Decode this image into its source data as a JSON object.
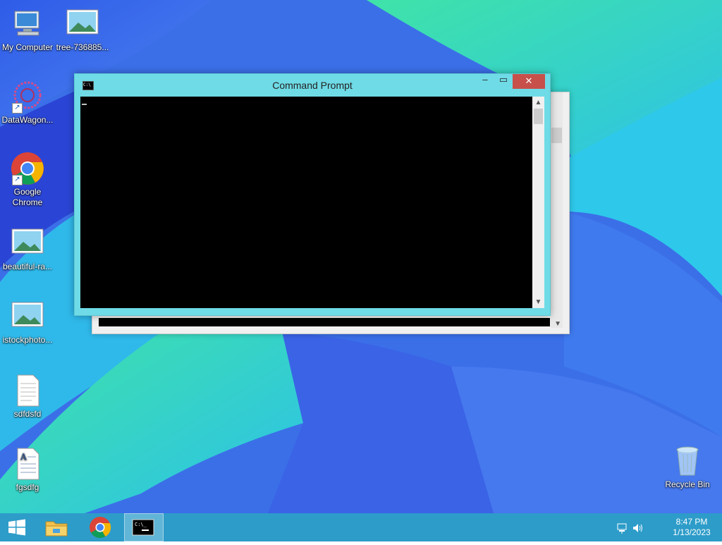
{
  "desktop": {
    "icons": [
      {
        "label": "My Computer",
        "icon": "computer-icon"
      },
      {
        "label": "tree-736885...",
        "icon": "image-file-icon"
      },
      {
        "label": "DataWagon...",
        "icon": "datawagon-icon"
      },
      {
        "label": "Google Chrome",
        "icon": "chrome-icon"
      },
      {
        "label": "beautiful-ra...",
        "icon": "image-file-icon"
      },
      {
        "label": "istockphoto...",
        "icon": "image-file-icon"
      },
      {
        "label": "sdfdsfd",
        "icon": "text-file-icon"
      },
      {
        "label": "fgsdfg",
        "icon": "document-file-icon"
      },
      {
        "label": "Recycle Bin",
        "icon": "recycle-bin-icon"
      }
    ]
  },
  "cmd_window": {
    "title": "Command Prompt",
    "icon": "cmd-icon",
    "minimize_label": "–",
    "maximize_label": "▭",
    "close_label": "✕"
  },
  "taskbar": {
    "start": "windows-start-icon",
    "pinned": [
      "file-explorer-icon",
      "chrome-icon",
      "cmd-icon"
    ],
    "clock_time": "8:47 PM",
    "clock_date": "1/13/2023"
  },
  "colors": {
    "taskbar": "#2d9cc9",
    "window_frame": "#6fdbe6",
    "close_button": "#c7504b"
  }
}
